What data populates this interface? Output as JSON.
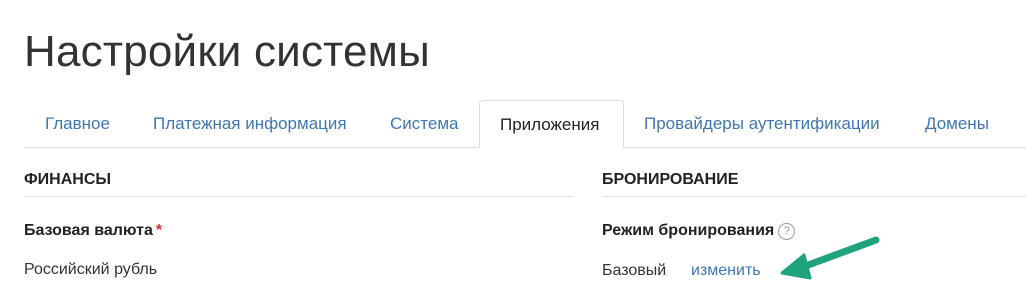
{
  "page": {
    "title": "Настройки системы"
  },
  "tabs": [
    {
      "label": "Главное",
      "active": false
    },
    {
      "label": "Платежная информация",
      "active": false
    },
    {
      "label": "Система",
      "active": false
    },
    {
      "label": "Приложения",
      "active": true
    },
    {
      "label": "Провайдеры аутентификации",
      "active": false
    },
    {
      "label": "Домены",
      "active": false
    }
  ],
  "finance": {
    "header": "ФИНАНСЫ",
    "currency_label": "Базовая валюта",
    "required_mark": "*",
    "currency_value": "Российский рубль"
  },
  "booking": {
    "header": "БРОНИРОВАНИЕ",
    "mode_label": "Режим бронирования",
    "help_icon_glyph": "?",
    "mode_value": "Базовый",
    "change_link": "изменить"
  },
  "colors": {
    "link": "#3f77b3",
    "required": "#d9352f",
    "annotation_arrow": "#1fa37d"
  },
  "icons": {
    "help": "question-circle-icon",
    "annotation": "arrow-pointer-icon"
  }
}
